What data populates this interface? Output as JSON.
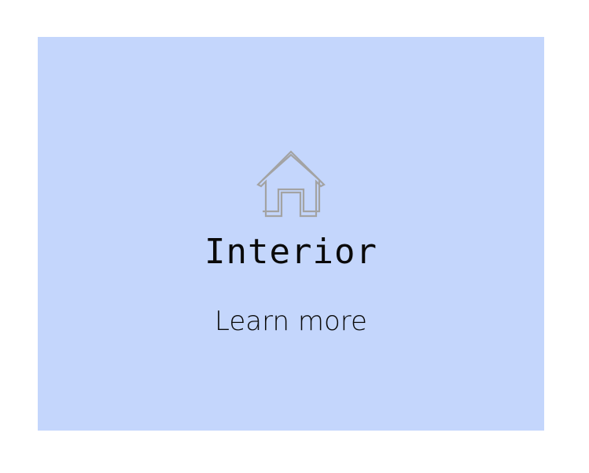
{
  "card": {
    "title": "Interior",
    "link_label": "Learn more",
    "icon": "house-icon",
    "background_color": "#c4d6fc",
    "icon_color": "#a0a0a0"
  }
}
